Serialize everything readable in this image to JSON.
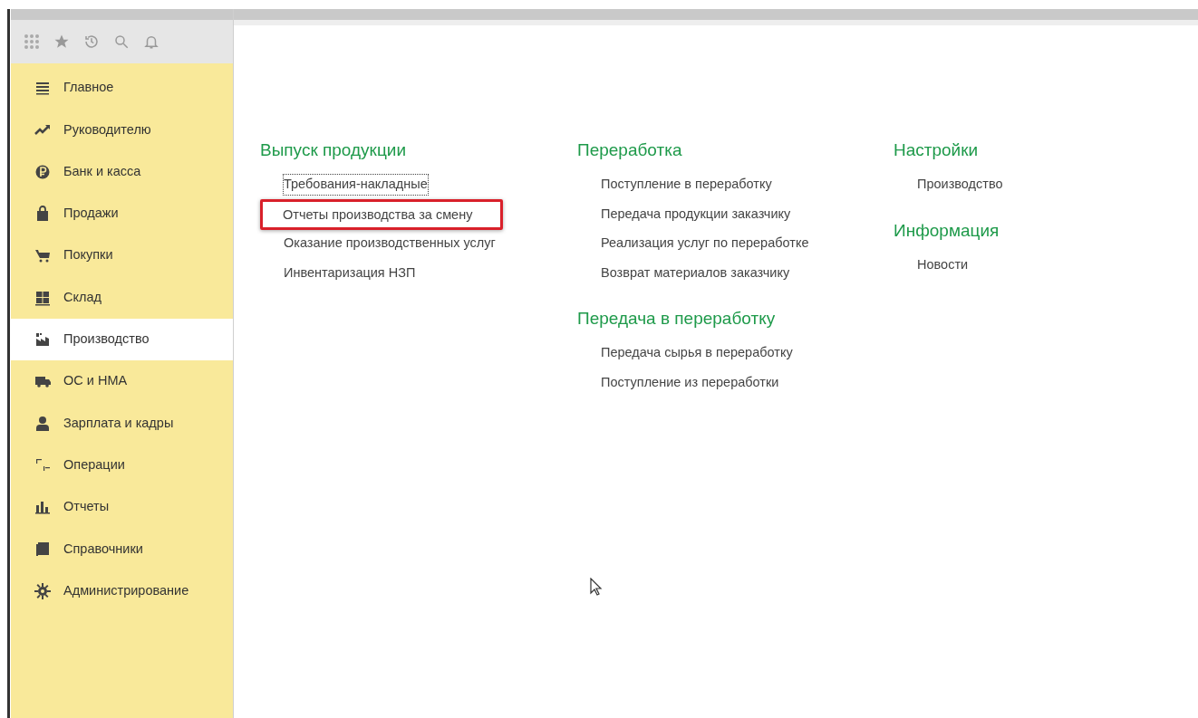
{
  "sidebar": {
    "items": [
      {
        "label": "Главное",
        "selected": false
      },
      {
        "label": "Руководителю",
        "selected": false
      },
      {
        "label": "Банк и касса",
        "selected": false
      },
      {
        "label": "Продажи",
        "selected": false
      },
      {
        "label": "Покупки",
        "selected": false
      },
      {
        "label": "Склад",
        "selected": false
      },
      {
        "label": "Производство",
        "selected": true
      },
      {
        "label": "ОС и НМА",
        "selected": false
      },
      {
        "label": "Зарплата и кадры",
        "selected": false
      },
      {
        "label": "Операции",
        "selected": false
      },
      {
        "label": "Отчеты",
        "selected": false
      },
      {
        "label": "Справочники",
        "selected": false
      },
      {
        "label": "Администрирование",
        "selected": false
      }
    ]
  },
  "columns": [
    {
      "sections": [
        {
          "title": "Выпуск продукции",
          "items": [
            {
              "label": "Требования-накладные",
              "focused": true,
              "highlighted": false
            },
            {
              "label": "Отчеты производства за смену",
              "focused": false,
              "highlighted": true
            },
            {
              "label": "Оказание производственных услуг",
              "focused": false,
              "highlighted": false
            },
            {
              "label": "Инвентаризация НЗП",
              "focused": false,
              "highlighted": false
            }
          ]
        }
      ]
    },
    {
      "sections": [
        {
          "title": "Переработка",
          "items": [
            {
              "label": "Поступление в переработку",
              "focused": false,
              "highlighted": false
            },
            {
              "label": "Передача продукции заказчику",
              "focused": false,
              "highlighted": false
            },
            {
              "label": "Реализация услуг по переработке",
              "focused": false,
              "highlighted": false
            },
            {
              "label": "Возврат материалов заказчику",
              "focused": false,
              "highlighted": false
            }
          ]
        },
        {
          "title": "Передача в переработку",
          "items": [
            {
              "label": "Передача сырья в переработку",
              "focused": false,
              "highlighted": false
            },
            {
              "label": "Поступление из переработки",
              "focused": false,
              "highlighted": false
            }
          ]
        }
      ]
    },
    {
      "sections": [
        {
          "title": "Настройки",
          "items": [
            {
              "label": "Производство",
              "focused": false,
              "highlighted": false
            }
          ]
        },
        {
          "title": "Информация",
          "items": [
            {
              "label": "Новости",
              "focused": false,
              "highlighted": false
            }
          ]
        }
      ]
    }
  ]
}
